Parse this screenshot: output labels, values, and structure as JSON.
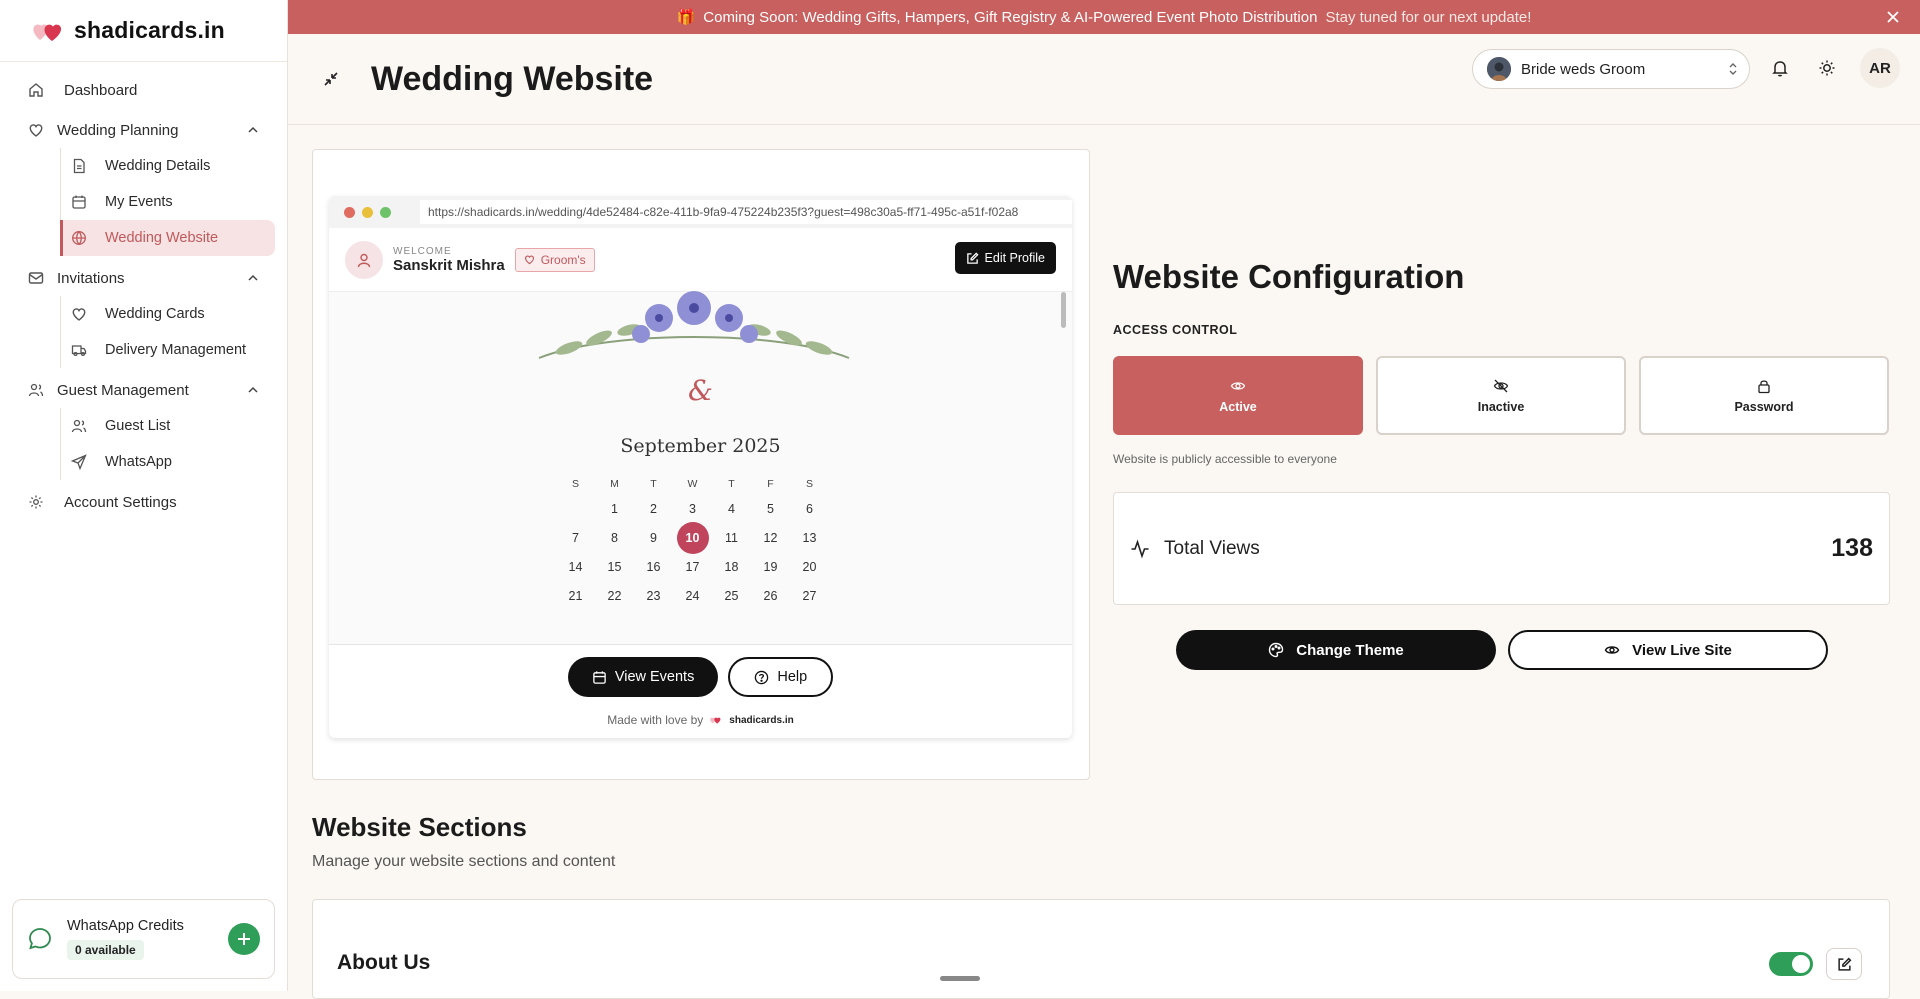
{
  "brand": {
    "name": "shadicards.in"
  },
  "sidebar": {
    "dashboard": "Dashboard",
    "planning": {
      "label": "Wedding Planning",
      "items": [
        "Wedding Details",
        "My Events",
        "Wedding Website"
      ]
    },
    "invitations": {
      "label": "Invitations",
      "items": [
        "Wedding Cards",
        "Delivery Management"
      ]
    },
    "guests": {
      "label": "Guest Management",
      "items": [
        "Guest List",
        "WhatsApp"
      ]
    },
    "account": "Account Settings",
    "credits": {
      "title": "WhatsApp Credits",
      "available": "0 available"
    }
  },
  "banner": {
    "emoji": "🎁",
    "text": "Coming Soon: Wedding Gifts, Hampers, Gift Registry & AI-Powered Event Photo Distribution",
    "sub": "Stay tuned for our next update!"
  },
  "header": {
    "title": "Wedding Website",
    "couple": "Bride weds Groom",
    "user_initials": "AR"
  },
  "preview": {
    "url": "https://shadicards.in/wedding/4de52484-c82e-411b-9fa9-475224b235f3?guest=498c30a5-ff71-495c-a51f-f02a8",
    "welcome_label": "WELCOME",
    "guest_name": "Sanskrit Mishra",
    "side_badge": "Groom's",
    "edit_profile": "Edit Profile",
    "ampersand": "&",
    "month": "September 2025",
    "weekdays": [
      "S",
      "M",
      "T",
      "W",
      "T",
      "F",
      "S"
    ],
    "weeks": [
      [
        "",
        "1",
        "2",
        "3",
        "4",
        "5",
        "6"
      ],
      [
        "7",
        "8",
        "9",
        "10",
        "11",
        "12",
        "13"
      ],
      [
        "14",
        "15",
        "16",
        "17",
        "18",
        "19",
        "20"
      ],
      [
        "21",
        "22",
        "23",
        "24",
        "25",
        "26",
        "27"
      ]
    ],
    "highlight_day": "10",
    "view_events": "View Events",
    "help": "Help",
    "made_with": "Made with love by",
    "made_brand": "shadicards.in"
  },
  "config": {
    "title": "Website Configuration",
    "access_label": "ACCESS CONTROL",
    "options": [
      "Active",
      "Inactive",
      "Password"
    ],
    "selected": "Active",
    "note": "Website is publicly accessible to everyone",
    "views_label": "Total Views",
    "views_count": "138",
    "change_theme": "Change Theme",
    "view_live": "View Live Site"
  },
  "sections": {
    "title": "Website Sections",
    "subtitle": "Manage your website sections and content",
    "first": "About Us"
  },
  "colors": {
    "accent": "#c7605e",
    "success": "#2f9e58",
    "dark": "#111111"
  }
}
